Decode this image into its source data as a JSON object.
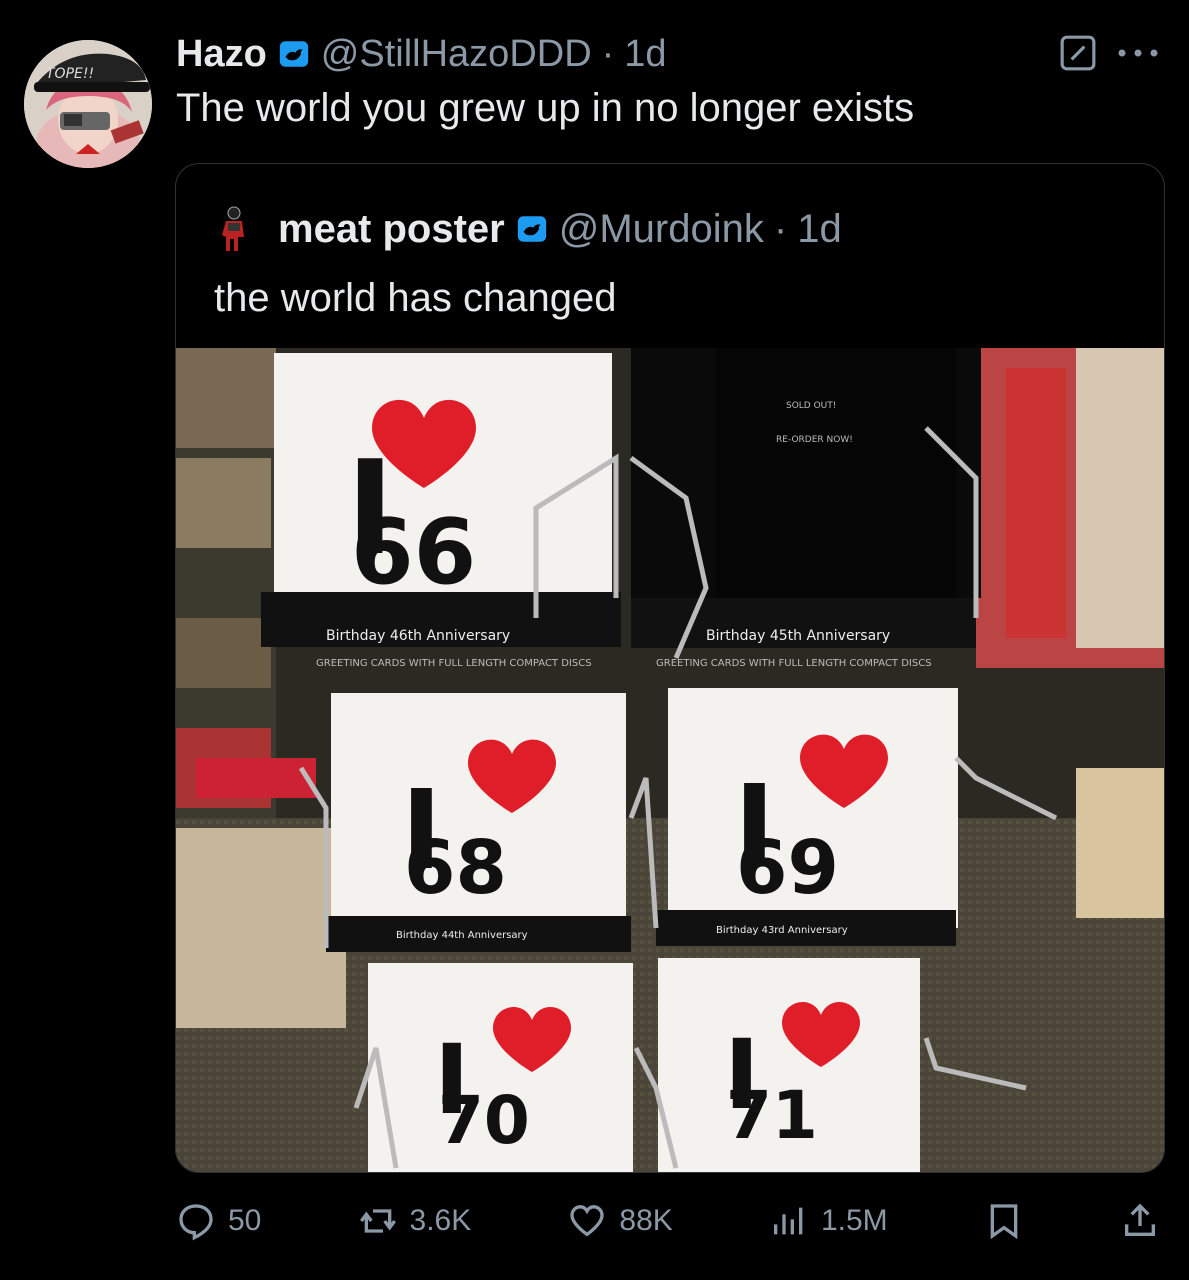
{
  "tweet": {
    "author_name": "Hazo",
    "author_handle": "@StillHazoDDD",
    "separator": "·",
    "time": "1d",
    "text": "The world you grew up in no longer exists",
    "avatar_hat_text": "TOPE!!"
  },
  "quoted": {
    "author_name": "meat poster",
    "author_handle": "@Murdoink",
    "separator": "·",
    "time": "1d",
    "text": "the world has changed",
    "image": {
      "cards": [
        {
          "year": "66",
          "heart_text": "I",
          "strip": "Birthday 46th Anniversary"
        },
        {
          "year": "68",
          "heart_text": "I",
          "strip": "Birthday 44th Anniversary"
        },
        {
          "year": "69",
          "heart_text": "I",
          "strip": "Birthday 43rd Anniversary"
        },
        {
          "year": "70",
          "heart_text": "I"
        },
        {
          "year": "71",
          "heart_text": "I"
        }
      ],
      "strip_left": "Birthday 46th Anniversary",
      "strip_right": "Birthday 45th Anniversary",
      "strip_sub": "GREETING CARDS WITH FULL LENGTH COMPACT DISCS",
      "sold_out": "SOLD OUT!",
      "reorder": "RE-ORDER NOW!"
    }
  },
  "actions": {
    "replies": "50",
    "reposts": "3.6K",
    "likes": "88K",
    "views": "1.5M"
  },
  "icons": {
    "verified": "verified-badge-icon",
    "edit": "edit-icon",
    "more": "more-icon",
    "reply": "reply-icon",
    "repost": "repost-icon",
    "like": "heart-icon",
    "views": "views-icon",
    "bookmark": "bookmark-icon",
    "share": "share-icon"
  },
  "colors": {
    "background": "#000000",
    "text": "#e7e9ea",
    "muted": "#8b98a5",
    "verified": "#1d9bf0",
    "border": "#2f3336"
  }
}
